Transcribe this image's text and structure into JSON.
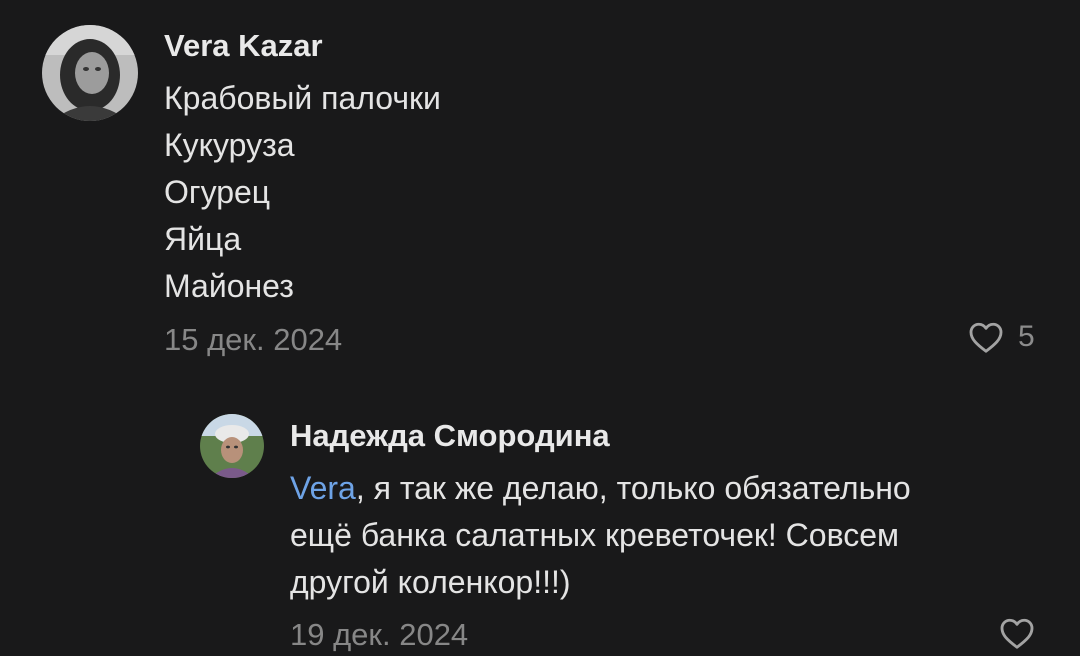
{
  "comments": [
    {
      "author": "Vera Kazar",
      "lines": [
        "Крабовый палочки",
        "Кукуруза",
        "Огурец",
        "Яйца",
        "Майонез"
      ],
      "date": "15 дек. 2024",
      "likes": "5"
    }
  ],
  "reply": {
    "author": "Надежда Смородина",
    "mention": "Vera",
    "line1_rest": ", я так же делаю, только обязательно",
    "line2": "ещё банка салатных креветочек! Совсем",
    "line3": "другой коленкор!!!)",
    "date": "19 дек. 2024",
    "likes": ""
  },
  "icons": {
    "like": "heart-outline-icon"
  },
  "colors": {
    "background": "#19191a",
    "mention": "#6ea3e6",
    "meta": "#878787"
  }
}
